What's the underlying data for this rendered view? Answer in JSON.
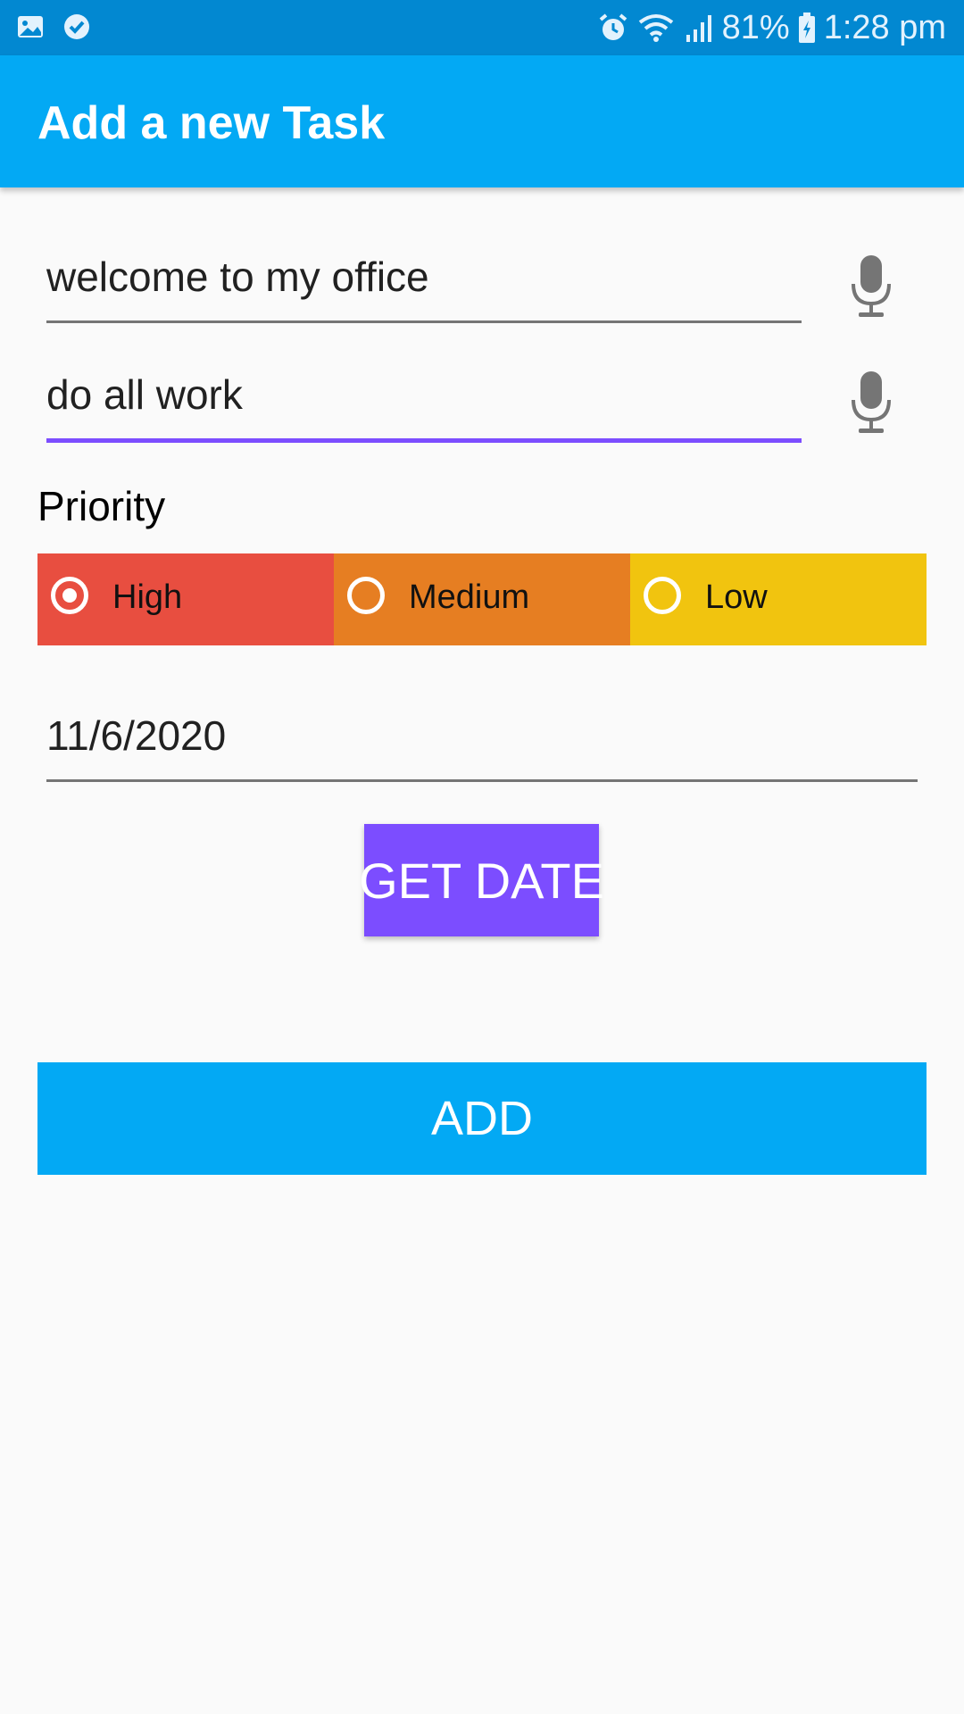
{
  "status_bar": {
    "battery": "81%",
    "time": "1:28 pm",
    "icons": [
      "gallery-icon",
      "check-circle-icon",
      "alarm-icon",
      "wifi-icon",
      "signal-icon",
      "battery-icon"
    ]
  },
  "app_bar": {
    "title": "Add a new Task"
  },
  "form": {
    "title_value": "welcome to my office",
    "description_value": "do all work",
    "priority_label": "Priority",
    "priority_options": [
      {
        "label": "High",
        "color": "#e84e40",
        "selected": true
      },
      {
        "label": "Medium",
        "color": "#e67e22",
        "selected": false
      },
      {
        "label": "Low",
        "color": "#f1c40f",
        "selected": false
      }
    ],
    "date_value": "11/6/2020",
    "get_date_label": "GET DATE",
    "add_label": "ADD"
  },
  "colors": {
    "primary": "#03a9f4",
    "primary_dark": "#0288d1",
    "accent": "#7c4dff"
  }
}
